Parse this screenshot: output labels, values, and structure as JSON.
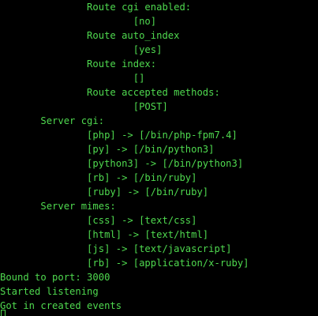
{
  "terminal": {
    "lines": [
      "               Route cgi enabled:",
      "                       [no]",
      "               Route auto_index",
      "                       [yes]",
      "               Route index:",
      "                       []",
      "               Route accepted methods:",
      "                       [POST]",
      "       Server cgi:",
      "               [php] -> [/bin/php-fpm7.4]",
      "               [py] -> [/bin/python3]",
      "               [python3] -> [/bin/python3]",
      "               [rb] -> [/bin/ruby]",
      "               [ruby] -> [/bin/ruby]",
      "       Server mimes:",
      "               [css] -> [text/css]",
      "               [html] -> [text/html]",
      "               [js] -> [text/javascript]",
      "               [rb] -> [application/x-ruby]",
      "Bound to port: 3000",
      "Started listening",
      "Got in created events"
    ],
    "text_color": "#4fd94f",
    "background_color": "#000000"
  }
}
